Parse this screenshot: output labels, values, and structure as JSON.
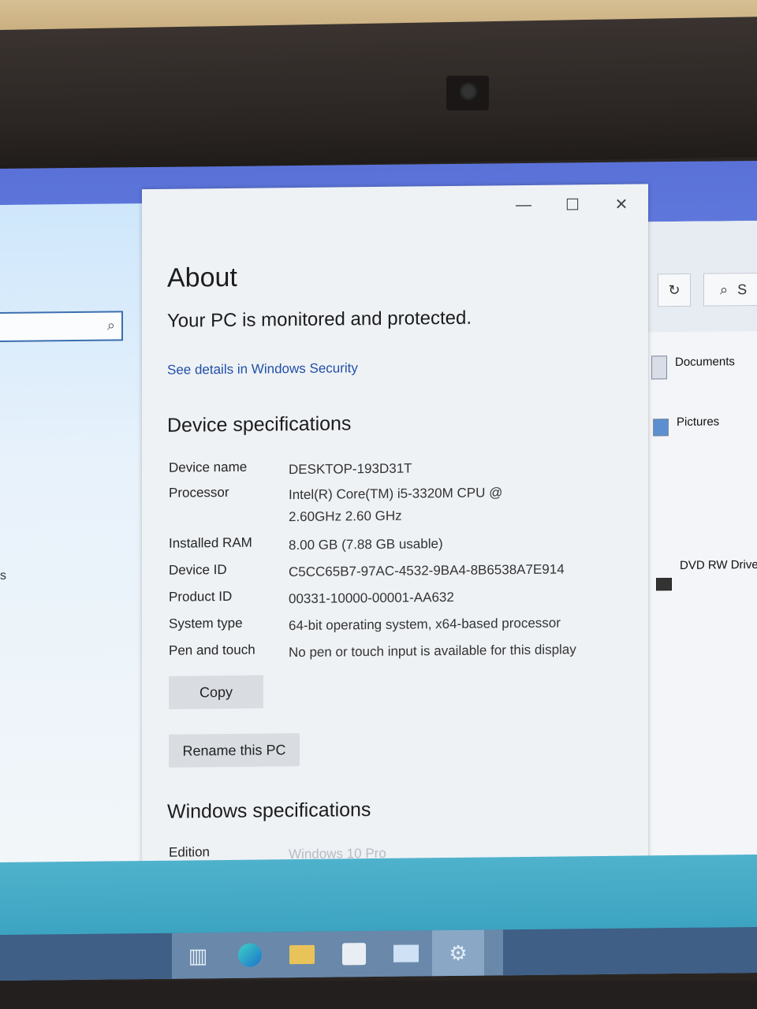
{
  "about_window": {
    "title": "About",
    "security_status": "Your PC is monitored and protected.",
    "security_link": "See details in Windows Security",
    "controls": {
      "minimize": "—",
      "maximize": "☐",
      "close": "✕"
    },
    "device_specifications": {
      "heading": "Device specifications",
      "rows": [
        {
          "label": "Device name",
          "value": "DESKTOP-193D31T"
        },
        {
          "label": "Processor",
          "value": "Intel(R) Core(TM) i5-3320M CPU @ 2.60GHz   2.60 GHz"
        },
        {
          "label": "Installed RAM",
          "value": "8.00 GB (7.88 GB usable)"
        },
        {
          "label": "Device ID",
          "value": "C5CC65B7-97AC-4532-9BA4-8B6538A7E914"
        },
        {
          "label": "Product ID",
          "value": "00331-10000-00001-AA632"
        },
        {
          "label": "System type",
          "value": "64-bit operating system, x64-based processor"
        },
        {
          "label": "Pen and touch",
          "value": "No pen or touch input is available for this display"
        }
      ],
      "copy_button": "Copy",
      "rename_button": "Rename this PC"
    },
    "windows_specifications": {
      "heading": "Windows specifications",
      "rows": [
        {
          "label": "Edition",
          "value": "Windows 10 Pro"
        }
      ]
    }
  },
  "background_explorer": {
    "items": [
      "Documents",
      "Pictures",
      "DVD RW Drive"
    ],
    "search_fragment": "S"
  },
  "background_settings": {
    "fragment": "s"
  },
  "taskbar": {
    "icons": [
      "task-view-icon",
      "edge-icon",
      "file-explorer-icon",
      "store-icon",
      "mail-icon",
      "settings-icon"
    ]
  }
}
